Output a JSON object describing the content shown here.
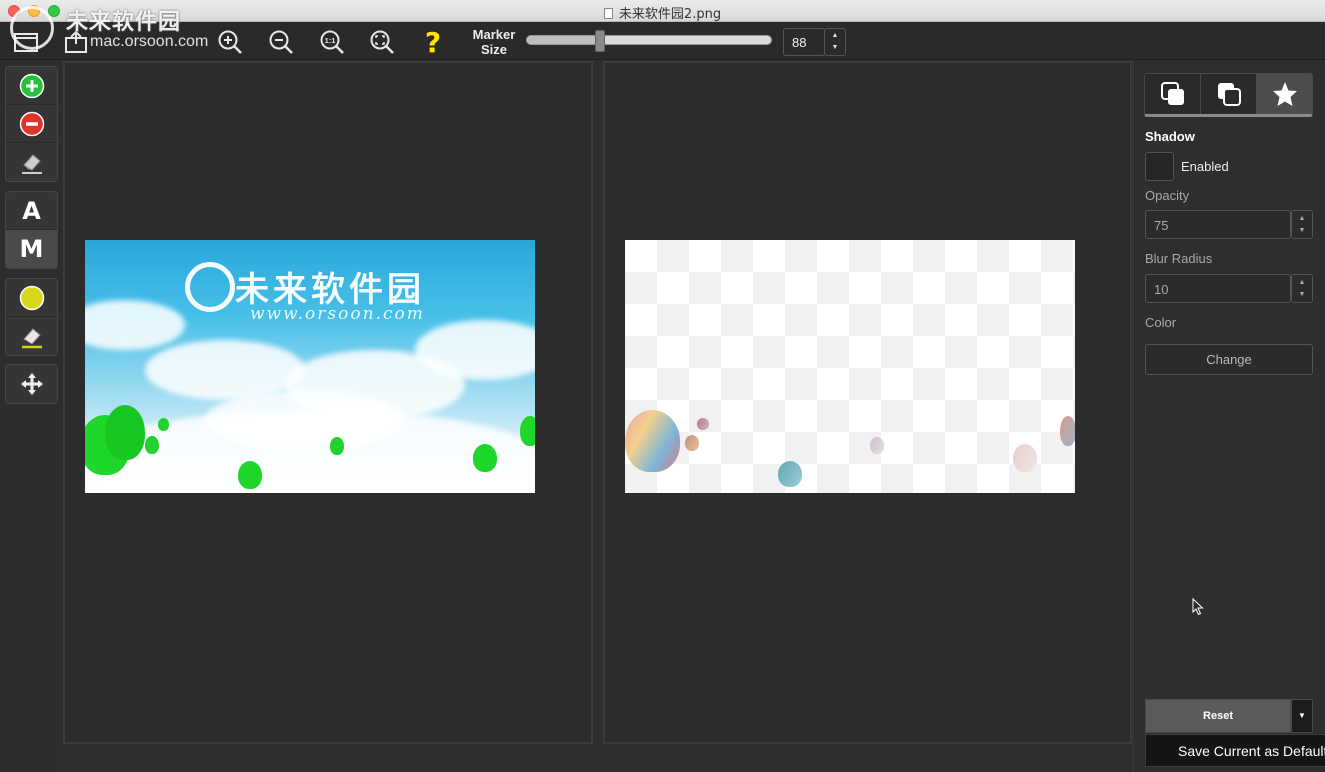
{
  "window": {
    "title": "未来软件园2.png"
  },
  "watermark": {
    "brand": "未来软件园",
    "url": "mac.orsoon.com"
  },
  "toolbar": {
    "marker_label_line1": "Marker",
    "marker_label_line2": "Size",
    "marker_size_value": "88",
    "marker_size_fraction": 0.3,
    "icons": [
      "open-icon",
      "save-icon",
      "zoom-in-icon",
      "zoom-out-icon",
      "actual-size-icon",
      "fit-icon",
      "help-icon"
    ],
    "actual_size_glyph": "1:1",
    "help_glyph": "?"
  },
  "tools": {
    "group1": [
      "add-marker",
      "remove-marker",
      "eraser"
    ],
    "group2": [
      {
        "name": "auto-mode",
        "label": "A"
      },
      {
        "name": "manual-mode",
        "label": "M"
      }
    ],
    "group3": [
      "hair-marker",
      "hair-eraser"
    ],
    "group4": [
      "move"
    ]
  },
  "canvas": {
    "original_watermark_text": "未来软件园",
    "original_watermark_url": "www.orsoon.com"
  },
  "inspector": {
    "tabs": [
      "foreground-tab",
      "background-tab",
      "effects-tab"
    ],
    "active_tab": "effects-tab",
    "section": "Shadow",
    "enabled_label": "Enabled",
    "opacity_label": "Opacity",
    "opacity_value": "75",
    "blur_label": "Blur Radius",
    "blur_value": "10",
    "color_label": "Color",
    "change_label": "Change",
    "reset_label": "Reset",
    "menu_item": "Save Current as Default"
  },
  "colors": {
    "add_green": "#27c23a",
    "remove_red": "#e0332b",
    "hair_yellow": "#d8d81a",
    "help_yellow": "#ffe500"
  }
}
